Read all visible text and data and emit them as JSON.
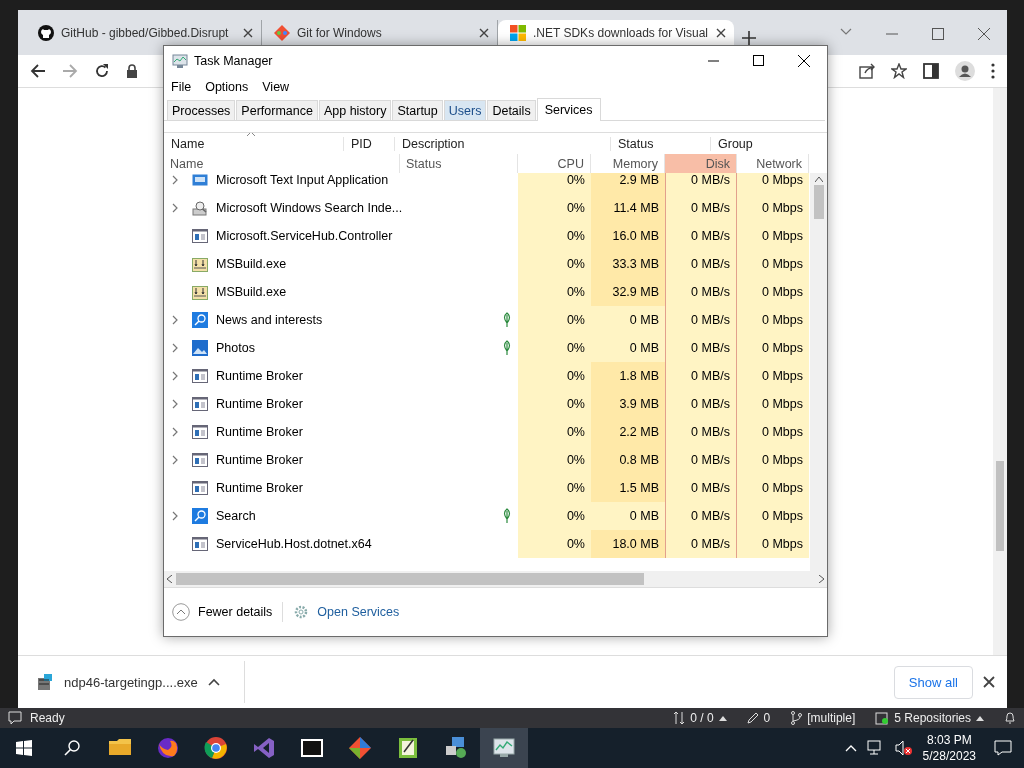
{
  "browser": {
    "tabs": [
      {
        "title": "GitHub - gibbed/Gibbed.Disrupt",
        "selected": false
      },
      {
        "title": "Git for Windows",
        "selected": false
      },
      {
        "title": ".NET SDKs downloads for Visual",
        "selected": true
      }
    ],
    "download": {
      "file": "ndp46-targetingp....exe",
      "show_all": "Show all"
    }
  },
  "task_manager": {
    "title": "Task Manager",
    "menu": [
      "File",
      "Options",
      "View"
    ],
    "tabs": [
      {
        "label": "Processes",
        "selected": false,
        "hovered": false
      },
      {
        "label": "Performance",
        "selected": false,
        "hovered": false
      },
      {
        "label": "App history",
        "selected": false,
        "hovered": false
      },
      {
        "label": "Startup",
        "selected": false,
        "hovered": false
      },
      {
        "label": "Users",
        "selected": false,
        "hovered": true
      },
      {
        "label": "Details",
        "selected": false,
        "hovered": false
      },
      {
        "label": "Services",
        "selected": true,
        "hovered": false
      }
    ],
    "service_columns": [
      "Name",
      "PID",
      "Description",
      "Status",
      "Group"
    ],
    "columns": [
      {
        "label": "Name",
        "highlighted": false
      },
      {
        "label": "Status",
        "highlighted": false
      },
      {
        "label": "CPU",
        "highlighted": false
      },
      {
        "label": "Memory",
        "highlighted": false
      },
      {
        "label": "Disk",
        "highlighted": true
      },
      {
        "label": "Network",
        "highlighted": false
      }
    ],
    "rows": [
      {
        "name": "Microsoft Text Input Application",
        "kind": "keyboard",
        "expandable": true,
        "suspended": false,
        "cpu": "0%",
        "memory": "2.9 MB",
        "memory_heavy": true,
        "disk": "0 MB/s",
        "network": "0 Mbps"
      },
      {
        "name": "Microsoft Windows Search Inde...",
        "kind": "indexer",
        "expandable": true,
        "suspended": false,
        "cpu": "0%",
        "memory": "11.4 MB",
        "memory_heavy": true,
        "disk": "0 MB/s",
        "network": "0 Mbps"
      },
      {
        "name": "Microsoft.ServiceHub.Controller",
        "kind": "window",
        "expandable": false,
        "suspended": false,
        "cpu": "0%",
        "memory": "16.0 MB",
        "memory_heavy": true,
        "disk": "0 MB/s",
        "network": "0 Mbps"
      },
      {
        "name": "MSBuild.exe",
        "kind": "build",
        "expandable": false,
        "suspended": false,
        "cpu": "0%",
        "memory": "33.3 MB",
        "memory_heavy": true,
        "disk": "0 MB/s",
        "network": "0 Mbps"
      },
      {
        "name": "MSBuild.exe",
        "kind": "build",
        "expandable": false,
        "suspended": false,
        "cpu": "0%",
        "memory": "32.9 MB",
        "memory_heavy": true,
        "disk": "0 MB/s",
        "network": "0 Mbps"
      },
      {
        "name": "News and interests",
        "kind": "search",
        "expandable": true,
        "suspended": true,
        "cpu": "0%",
        "memory": "0 MB",
        "memory_heavy": false,
        "disk": "0 MB/s",
        "network": "0 Mbps"
      },
      {
        "name": "Photos",
        "kind": "photos",
        "expandable": true,
        "suspended": true,
        "cpu": "0%",
        "memory": "0 MB",
        "memory_heavy": false,
        "disk": "0 MB/s",
        "network": "0 Mbps"
      },
      {
        "name": "Runtime Broker",
        "kind": "window",
        "expandable": true,
        "suspended": false,
        "cpu": "0%",
        "memory": "1.8 MB",
        "memory_heavy": true,
        "disk": "0 MB/s",
        "network": "0 Mbps"
      },
      {
        "name": "Runtime Broker",
        "kind": "window",
        "expandable": true,
        "suspended": false,
        "cpu": "0%",
        "memory": "3.9 MB",
        "memory_heavy": true,
        "disk": "0 MB/s",
        "network": "0 Mbps"
      },
      {
        "name": "Runtime Broker",
        "kind": "window",
        "expandable": true,
        "suspended": false,
        "cpu": "0%",
        "memory": "2.2 MB",
        "memory_heavy": true,
        "disk": "0 MB/s",
        "network": "0 Mbps"
      },
      {
        "name": "Runtime Broker",
        "kind": "window",
        "expandable": true,
        "suspended": false,
        "cpu": "0%",
        "memory": "0.8 MB",
        "memory_heavy": true,
        "disk": "0 MB/s",
        "network": "0 Mbps"
      },
      {
        "name": "Runtime Broker",
        "kind": "window",
        "expandable": false,
        "suspended": false,
        "cpu": "0%",
        "memory": "1.5 MB",
        "memory_heavy": true,
        "disk": "0 MB/s",
        "network": "0 Mbps"
      },
      {
        "name": "Search",
        "kind": "search",
        "expandable": true,
        "suspended": true,
        "cpu": "0%",
        "memory": "0 MB",
        "memory_heavy": false,
        "disk": "0 MB/s",
        "network": "0 Mbps"
      },
      {
        "name": "ServiceHub.Host.dotnet.x64",
        "kind": "window",
        "expandable": false,
        "suspended": false,
        "cpu": "0%",
        "memory": "18.0 MB",
        "memory_heavy": true,
        "disk": "0 MB/s",
        "network": "0 Mbps"
      }
    ],
    "footer": {
      "fewer_details": "Fewer details",
      "open_services": "Open Services"
    }
  },
  "status_bar": {
    "status": "Ready",
    "sync": "0 / 0",
    "edits": "0",
    "branch": "[multiple]",
    "repositories": "5 Repositories"
  },
  "taskbar": {
    "apps": [
      {
        "selected": false
      },
      {
        "selected": false
      },
      {
        "selected": false
      },
      {
        "selected": false
      },
      {
        "selected": false
      },
      {
        "selected": false
      },
      {
        "selected": false
      },
      {
        "selected": false
      },
      {
        "selected": true
      }
    ],
    "time": "8:03 PM",
    "date": "5/28/2023"
  }
}
